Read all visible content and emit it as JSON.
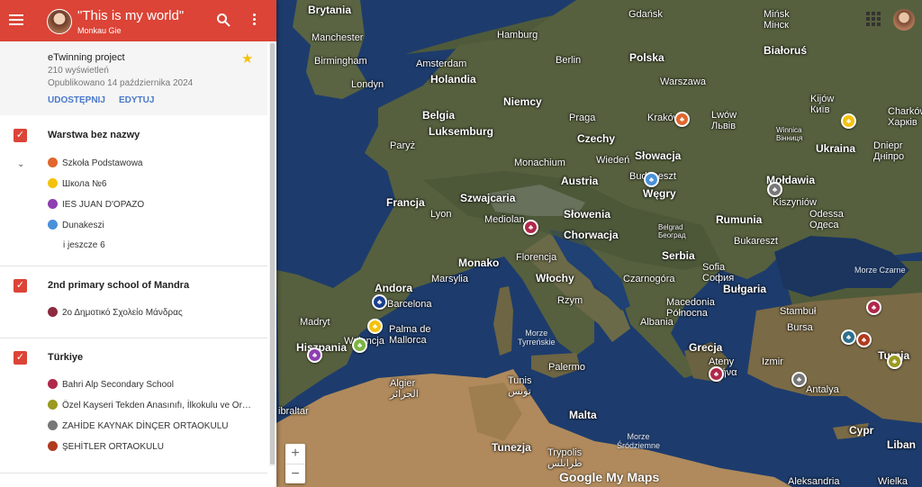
{
  "header": {
    "title": "\"This is my world\"",
    "subtitle": "Monkau Gie"
  },
  "info": {
    "project": "eTwinning project",
    "views": "210 wyświetleń",
    "published": "Opublikowano 14 października 2024",
    "share_label": "UDOSTĘPNIJ",
    "edit_label": "EDYTUJ"
  },
  "layers": [
    {
      "title": "Warstwa bez nazwy",
      "items": [
        {
          "label": "Szkoła Podstawowa",
          "color": "#e0672d"
        },
        {
          "label": "Школа №6",
          "color": "#f4c20d"
        },
        {
          "label": "IES JUAN D'OPAZO",
          "color": "#8e3fb0"
        },
        {
          "label": "Dunakeszi",
          "color": "#4a90d9"
        }
      ],
      "more": "i jeszcze 6"
    },
    {
      "title": "2nd primary school of Mandra",
      "items": [
        {
          "label": "2ο Δημοτικό Σχολείο Μάνδρας",
          "color": "#8b2b3f"
        }
      ]
    },
    {
      "title": "Türkiye",
      "items": [
        {
          "label": "Bahri Alp Secondary School",
          "color": "#b0284a"
        },
        {
          "label": "Özel Kayseri Tekden Anasınıfı, İlkokulu ve Or…",
          "color": "#9a9a20"
        },
        {
          "label": "ZAHİDE KAYNAK DİNÇER ORTAOKULU",
          "color": "#777777"
        },
        {
          "label": "ŞEHİTLER ORTAOKULU",
          "color": "#b03a1e"
        }
      ]
    }
  ],
  "map": {
    "labels": {
      "brytania": "Brytania",
      "manchester": "Manchester",
      "birmingham": "Birmingham",
      "londyn": "Londyn",
      "amsterdam": "Amsterdam",
      "holandia": "Holandia",
      "hamburg": "Hamburg",
      "berlin": "Berlin",
      "gdansk": "Gdańsk",
      "polska": "Polska",
      "warszawa": "Warszawa",
      "minsk": "Mińsk\nМінск",
      "bialorus": "Białoruś",
      "niemcy": "Niemcy",
      "belgia": "Belgia",
      "luksemburg": "Luksemburg",
      "paryz": "Paryż",
      "praga": "Praga",
      "krakow": "Kraków",
      "lwow": "Lwów\nЛьвів",
      "kijow": "Kijów\nКиїв",
      "charkow": "Charków\nХарків",
      "czechy": "Czechy",
      "winnica": "Winnica\nВінниця",
      "ukraina": "Ukraina",
      "monachium": "Monachium",
      "wieden": "Wiedeń",
      "slowacja": "Słowacja",
      "dniepr": "Dniepr\nДніпро",
      "budapeszt": "Budapeszt",
      "austria": "Austria",
      "wegry": "Węgry",
      "moldawia": "Mołdawia",
      "kiszyniow": "Kiszyniów",
      "francja": "Francja",
      "szwajcaria": "Szwajcaria",
      "odessa": "Odessa\nОдеса",
      "lyon": "Lyon",
      "mediolan": "Mediolan",
      "slowenia": "Słowenia",
      "chorwacja": "Chorwacja",
      "rumunia": "Rumunia",
      "belgrad": "Belgrad\nБеоград",
      "bukareszt": "Bukareszt",
      "serbia": "Serbia",
      "monako": "Monako",
      "florencja": "Florencja",
      "sofia": "Sofia\nСофия",
      "bulgaria": "Bułgaria",
      "andora": "Andora",
      "marsylia": "Marsylia",
      "wlochy": "Włochy",
      "czarnogora": "Czarnogóra",
      "morze_czarne": "Morze Czarne",
      "barcelona": "Barcelona",
      "rzym": "Rzym",
      "macedonia": "Macedonia\nPółnocna",
      "stambul": "Stambuł",
      "madryt": "Madryt",
      "palma": "Palma de\nMallorca",
      "morze_tyrrenskie": "Morze\nTyrreńskie",
      "albania": "Albania",
      "bursa": "Bursa",
      "hiszpania": "Hiszpania",
      "walencja": "Walencja",
      "grecja": "Grecja",
      "ateny": "Ateny\nΑθήνα",
      "izmir": "Izmir",
      "turcja": "Turcja",
      "palermo": "Palermo",
      "antalya": "Antalya",
      "algier": "Algier\nالجزائر",
      "tunis": "Tunis\nتونس",
      "gibraltar": "ibraltar",
      "malta": "Malta",
      "cypr": "Cypr",
      "morze_srodziemne": "Morze\nŚródziemne",
      "liban": "Liban",
      "tunezja": "Tunezja",
      "trypolis": "Trypolis\nطرابلس",
      "aleksandria": "Aleksandria",
      "wielka": "Wielka"
    },
    "logo": "Google My Maps",
    "zoom_in": "+",
    "zoom_out": "−"
  }
}
